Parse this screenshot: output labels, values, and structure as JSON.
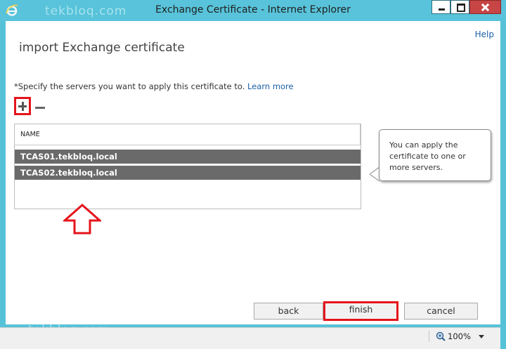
{
  "window": {
    "title": "Exchange Certificate - Internet Explorer",
    "watermark": "tekbloq.com"
  },
  "page": {
    "help_label": "Help",
    "title": "import Exchange certificate",
    "instruction": "*Specify the servers you want to apply this certificate to.",
    "learn_more": "Learn more"
  },
  "list": {
    "column_header": "NAME",
    "rows": [
      {
        "name": "TCAS01.tekbloq.local"
      },
      {
        "name": "TCAS02.tekbloq.local"
      }
    ]
  },
  "tooltip": {
    "text": "You can apply the certificate to one or more servers."
  },
  "buttons": {
    "back": "back",
    "finish": "finish",
    "cancel": "cancel"
  },
  "status": {
    "zoom": "100%"
  },
  "colors": {
    "titlebar": "#58c3da",
    "annotation_red": "#e5141b",
    "selected_row": "#6a6a6a",
    "link": "#1a5fa8"
  }
}
